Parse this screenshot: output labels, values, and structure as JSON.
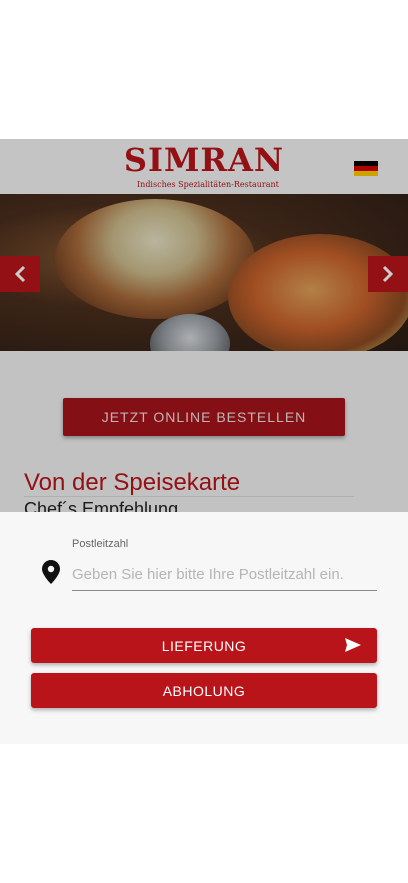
{
  "header": {
    "brand_name": "SIMRAN",
    "brand_subtitle": "Indisches Spezialitäten-Restaurant",
    "language_flag": "german-flag-icon"
  },
  "hero": {
    "prev_icon": "chevron-left-icon",
    "next_icon": "chevron-right-icon"
  },
  "main": {
    "order_button_label": "JETZT ONLINE BESTELLEN",
    "menu_heading": "Von der Speisekarte",
    "menu_subheading": "Chef´s Empfehlung"
  },
  "sheet": {
    "zip_label": "Postleitzahl",
    "zip_placeholder": "Geben Sie hier bitte Ihre Postleitzahl ein.",
    "zip_value": "",
    "delivery_label": "LIEFERUNG",
    "pickup_label": "ABHOLUNG",
    "location_icon": "location-pin-icon",
    "send_icon": "send-icon"
  },
  "colors": {
    "brand_red": "#b8141a",
    "flag_black": "#000000",
    "flag_red": "#dd0000",
    "flag_gold": "#ffce00"
  }
}
